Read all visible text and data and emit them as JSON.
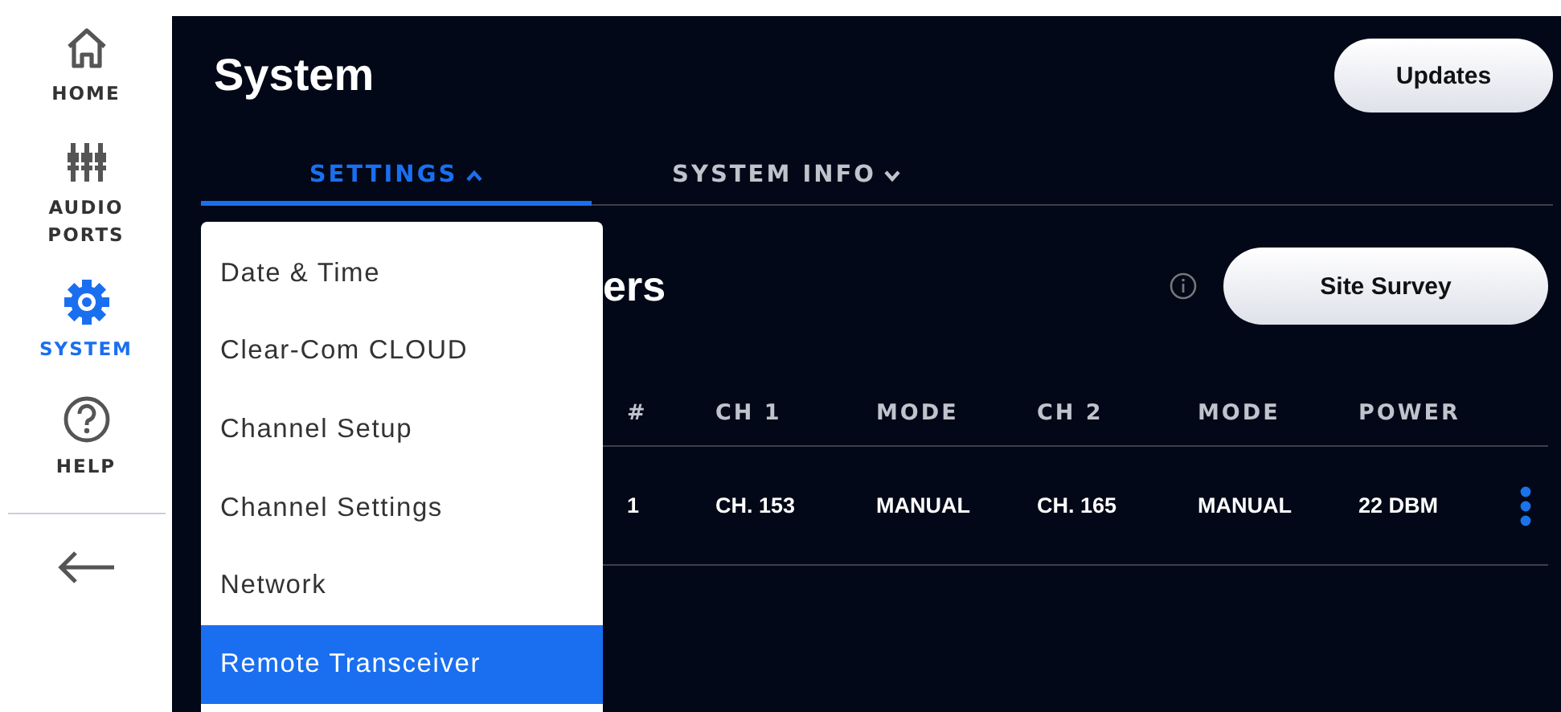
{
  "sidebar": {
    "items": [
      {
        "label": "HOME",
        "kind": "home",
        "selected": false
      },
      {
        "label": "AUDIO\nPORTS",
        "kind": "ports",
        "selected": false
      },
      {
        "label": "SYSTEM",
        "kind": "system",
        "selected": true
      },
      {
        "label": "HELP",
        "kind": "help",
        "selected": false
      }
    ]
  },
  "header": {
    "title": "System",
    "button": "Updates"
  },
  "tabs": [
    {
      "label": "SETTINGS",
      "selected": true,
      "expanded": true
    },
    {
      "label": "SYSTEM INFO",
      "selected": false,
      "expanded": false
    }
  ],
  "section": {
    "heading": "ers",
    "button": "Site Survey"
  },
  "table": {
    "columns": [
      "#",
      "CH 1",
      "MODE",
      "CH 2",
      "MODE",
      "POWER"
    ],
    "rows": [
      {
        "cells": [
          "1",
          "CH. 153",
          "MANUAL",
          "CH. 165",
          "MANUAL",
          "22 DBM"
        ]
      }
    ]
  },
  "menu": {
    "items": [
      {
        "label": "Date & Time",
        "selected": false
      },
      {
        "label": "Clear-Com CLOUD",
        "selected": false
      },
      {
        "label": "Channel Setup",
        "selected": false
      },
      {
        "label": "Channel Settings",
        "selected": false
      },
      {
        "label": "Network",
        "selected": false
      },
      {
        "label": "Remote Transceiver",
        "selected": true
      }
    ]
  }
}
